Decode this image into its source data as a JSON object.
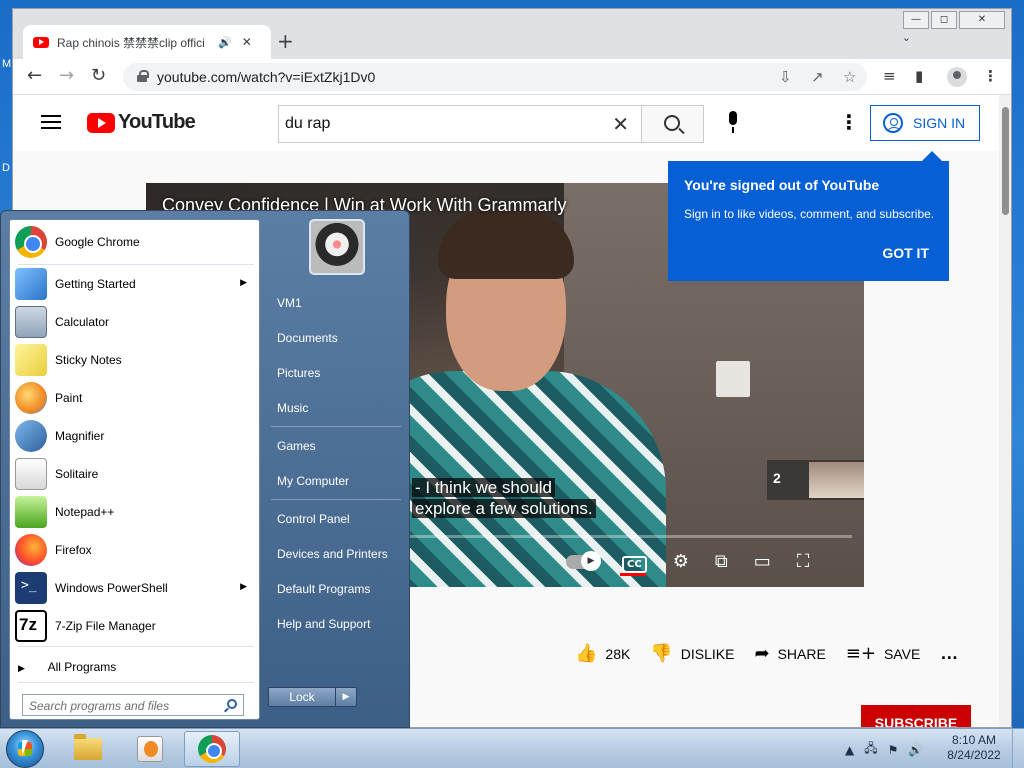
{
  "desktop": {
    "fragments": [
      "M",
      "D"
    ]
  },
  "browser": {
    "window_controls": {
      "minimize": "—",
      "restore": "◻",
      "close": "✕"
    },
    "tab": {
      "title": "Rap chinois 禁禁禁clip offici",
      "audio_icon": "speaker-icon",
      "close": "✕"
    },
    "new_tab": "+",
    "tab_search": "⌄",
    "toolbar": {
      "back": "←",
      "forward": "→",
      "reload": "↻",
      "url": "youtube.com/watch?v=iExtZkj1Dv0"
    }
  },
  "youtube": {
    "logo_text": "YouTube",
    "search": {
      "value": "du rap",
      "clear": "✕"
    },
    "menu_dots": "⋮",
    "sign_in": "SIGN IN",
    "tooltip": {
      "title": "You're signed out of YouTube",
      "body": "Sign in to like videos, comment, and subscribe.",
      "button": "GOT IT"
    },
    "video": {
      "title": "Convey Confidence | Win at Work With Grammarly",
      "caption": [
        "- I think we should",
        "explore a few solutions."
      ],
      "thumb_count": "2"
    },
    "actions": {
      "likes": "28K",
      "dislike": "DISLIKE",
      "share": "SHARE",
      "save": "SAVE",
      "more": "…"
    },
    "subscribe": "SUBSCRIBE"
  },
  "start_menu": {
    "programs": [
      {
        "label": "Google Chrome",
        "icon": "chrome-icon"
      },
      {
        "label": "Getting Started",
        "icon": "getting-started-icon",
        "submenu": true
      },
      {
        "label": "Calculator",
        "icon": "calculator-icon"
      },
      {
        "label": "Sticky Notes",
        "icon": "sticky-notes-icon"
      },
      {
        "label": "Paint",
        "icon": "paint-icon"
      },
      {
        "label": "Magnifier",
        "icon": "magnifier-icon"
      },
      {
        "label": "Solitaire",
        "icon": "solitaire-icon"
      },
      {
        "label": "Notepad++",
        "icon": "notepad-plus-icon"
      },
      {
        "label": "Firefox",
        "icon": "firefox-icon"
      },
      {
        "label": "Windows PowerShell",
        "icon": "powershell-icon",
        "submenu": true
      },
      {
        "label": "7-Zip File Manager",
        "icon": "7zip-icon"
      }
    ],
    "all_programs": "All Programs",
    "search_placeholder": "Search programs and files",
    "right": [
      "VM1",
      "Documents",
      "Pictures",
      "Music",
      "Games",
      "My Computer",
      "Control Panel",
      "Devices and Printers",
      "Default Programs",
      "Help and Support"
    ],
    "lock": "Lock"
  },
  "taskbar": {
    "time": "8:10 AM",
    "date": "8/24/2022"
  }
}
